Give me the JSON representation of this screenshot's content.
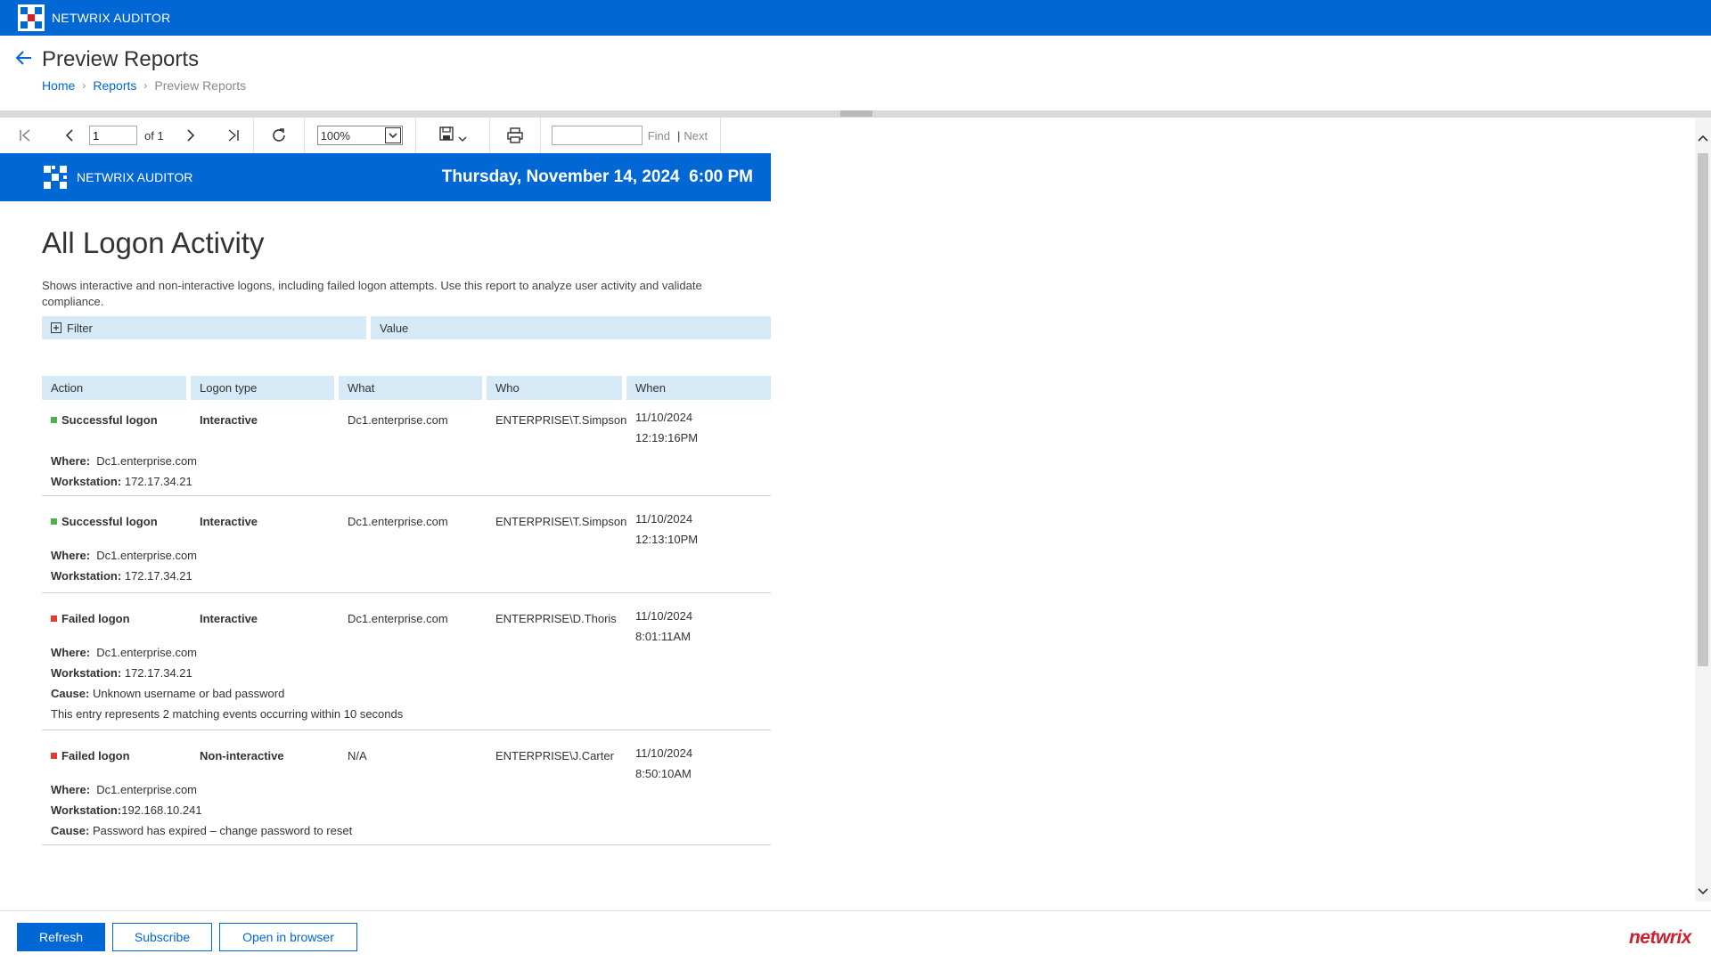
{
  "app": {
    "name": "NETWRIX AUDITOR"
  },
  "header": {
    "title": "Preview Reports",
    "breadcrumb": {
      "home": "Home",
      "reports": "Reports",
      "current": "Preview Reports"
    }
  },
  "toolbar": {
    "page_value": "1",
    "of_text": "of 1",
    "zoom": "100%",
    "find_label": "Find",
    "next_label": "Next",
    "sep": "|"
  },
  "report": {
    "brand": "NETWRIX AUDITOR",
    "date": "Thursday, November 14, 2024  6:00 PM",
    "title": "All Logon Activity",
    "description": "Shows interactive and non-interactive logons, including failed logon attempts. Use this report to analyze user activity and validate compliance.",
    "filter_header": "Filter",
    "value_header": "Value",
    "columns": [
      "Action",
      "Logon type",
      "What",
      "Who",
      "When"
    ],
    "rows": [
      {
        "action": "Successful logon",
        "status_color": "#4caf50",
        "logon_type": "Interactive",
        "what": "Dc1.enterprise.com",
        "who": "ENTERPRISE\\T.Simpson",
        "date": "11/10/2024",
        "time": "12:19:16PM",
        "where_label": "Where:",
        "where": "Dc1.enterprise.com",
        "workstation_label": "Workstation:",
        "workstation": "172.17.34.21"
      },
      {
        "action": "Successful logon",
        "status_color": "#4caf50",
        "logon_type": "Interactive",
        "what": "Dc1.enterprise.com",
        "who": "ENTERPRISE\\T.Simpson",
        "date": "11/10/2024",
        "time": "12:13:10PM",
        "where_label": "Where:",
        "where": "Dc1.enterprise.com",
        "workstation_label": "Workstation:",
        "workstation": "172.17.34.21"
      },
      {
        "action": "Failed logon",
        "status_color": "#e53935",
        "logon_type": "Interactive",
        "what": "Dc1.enterprise.com",
        "who": "ENTERPRISE\\D.Thoris",
        "date": "11/10/2024",
        "time": "8:01:11AM",
        "where_label": "Where:",
        "where": "Dc1.enterprise.com",
        "workstation_label": "Workstation:",
        "workstation": "172.17.34.21",
        "cause_label": "Cause:",
        "cause": "Unknown username or bad password",
        "note": "This entry represents 2 matching events occurring within 10 seconds"
      },
      {
        "action": "Failed logon",
        "status_color": "#e53935",
        "logon_type": "Non-interactive",
        "what": "N/A",
        "who": "ENTERPRISE\\J.Carter",
        "date": "11/10/2024",
        "time": "8:50:10AM",
        "where_label": "Where:",
        "where": "Dc1.enterprise.com",
        "workstation_label": "Workstation:",
        "workstation": "192.168.10.241",
        "cause_label": "Cause:",
        "cause": "Password has expired – change password to reset"
      }
    ]
  },
  "footer": {
    "refresh": "Refresh",
    "subscribe": "Subscribe",
    "open_in_browser": "Open in browser",
    "brand": "netwrix"
  },
  "colors": {
    "primary": "#0067d4",
    "header_cell": "#d6e9f7",
    "success": "#4caf50",
    "failure": "#e53935",
    "brand_red": "#d0202c"
  },
  "icons": [
    "netwrix-logo-icon",
    "back-arrow-icon",
    "first-page-icon",
    "prev-page-icon",
    "next-page-icon",
    "last-page-icon",
    "refresh-icon",
    "save-icon",
    "chevron-down-icon",
    "print-icon",
    "expand-icon",
    "scroll-up-icon",
    "scroll-down-icon"
  ]
}
